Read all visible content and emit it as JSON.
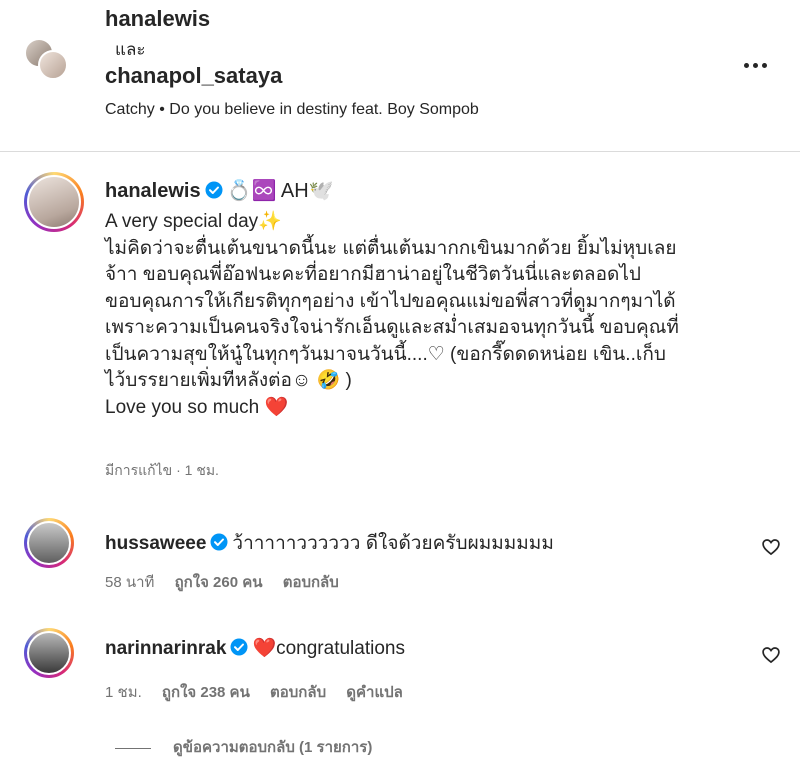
{
  "header": {
    "user1": "hanalewis",
    "and_text": "และ",
    "user2": "chanapol_sataya",
    "music": "Catchy • Do you believe in destiny feat. Boy Sompob"
  },
  "caption": {
    "username": "hanalewis",
    "emoji_after_name": "💍♾️ AH🕊️",
    "text": "A very special day✨\nไม่คิดว่าจะตื่นเต้นขนาดนี้นะ แต่ตื่นเต้นมากกเขินมากด้วย ยิ้มไม่หุบเลย\nจ้าา ขอบคุณพี่อ๊อฟนะคะที่อยากมีฮาน่าอยู่ในชีวิตวันนี่และตลอดไป\nขอบคุณการให้เกียรติทุกๆอย่าง เข้าไปขอคุณแม่ขอพี่สาวที่ดูมากๆมาได้\nเพราะความเป็นคนจริงใจน่ารักเอ็นดูและสม่ำเสมอจนทุกวันนี้ ขอบคุณที่\nเป็นความสุขให้นู๋ในทุกๆวันมาจนวันนี้....♡ (ขอกรี๊ดดดหน่อย เขิน..เก็บ\nไว้บรรยายเพิ่มทีหลังต่อ☺ 🤣 )\nLove you so much ❤️",
    "meta": "มีการแก้ไข · 1 ชม."
  },
  "comments": [
    {
      "username": "hussaweee",
      "text": "ว้าาาาาวววววว ดีใจด้วยครับผมมมมมม",
      "time": "58 นาที",
      "likes": "ถูกใจ 260 คน",
      "reply": "ตอบกลับ"
    },
    {
      "username": "narinnarinrak",
      "text": "❤️congratulations",
      "time": "1 ชม.",
      "likes": "ถูกใจ 238 คน",
      "reply": "ตอบกลับ",
      "translate": "ดูคำแปล"
    }
  ],
  "view_replies": "ดูข้อความตอบกลับ (1 รายการ)",
  "colors": {
    "verified": "#0095f6",
    "heart": "#ed4956",
    "secondary_text": "#737373"
  }
}
